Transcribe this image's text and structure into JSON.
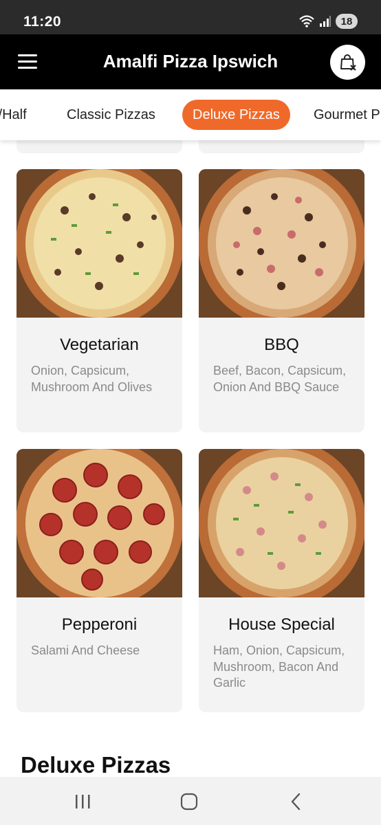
{
  "status_bar": {
    "time": "11:20",
    "battery": "18"
  },
  "header": {
    "title": "Amalfi Pizza Ipswich",
    "menu_icon": "hamburger-menu-icon",
    "cart_icon": "shopping-bag-icon"
  },
  "tabs": [
    {
      "label": "f/Half",
      "active": false
    },
    {
      "label": "Classic Pizzas",
      "active": false
    },
    {
      "label": "Deluxe Pizzas",
      "active": true
    },
    {
      "label": "Gourmet P",
      "active": false
    }
  ],
  "accent_color": "#ef6a2a",
  "products": [
    {
      "name": "Vegetarian",
      "description": "Onion, Capsicum, Mushroom And Olives"
    },
    {
      "name": "BBQ",
      "description": "Beef, Bacon, Capsicum, Onion And BBQ Sauce"
    },
    {
      "name": "Pepperoni",
      "description": "Salami And Cheese"
    },
    {
      "name": "House Special",
      "description": "Ham, Onion, Capsicum, Mushroom, Bacon And Garlic"
    }
  ],
  "section_heading": "Deluxe Pizzas",
  "nav": {
    "recents_icon": "recent-apps-icon",
    "home_icon": "home-icon",
    "back_icon": "back-icon"
  }
}
